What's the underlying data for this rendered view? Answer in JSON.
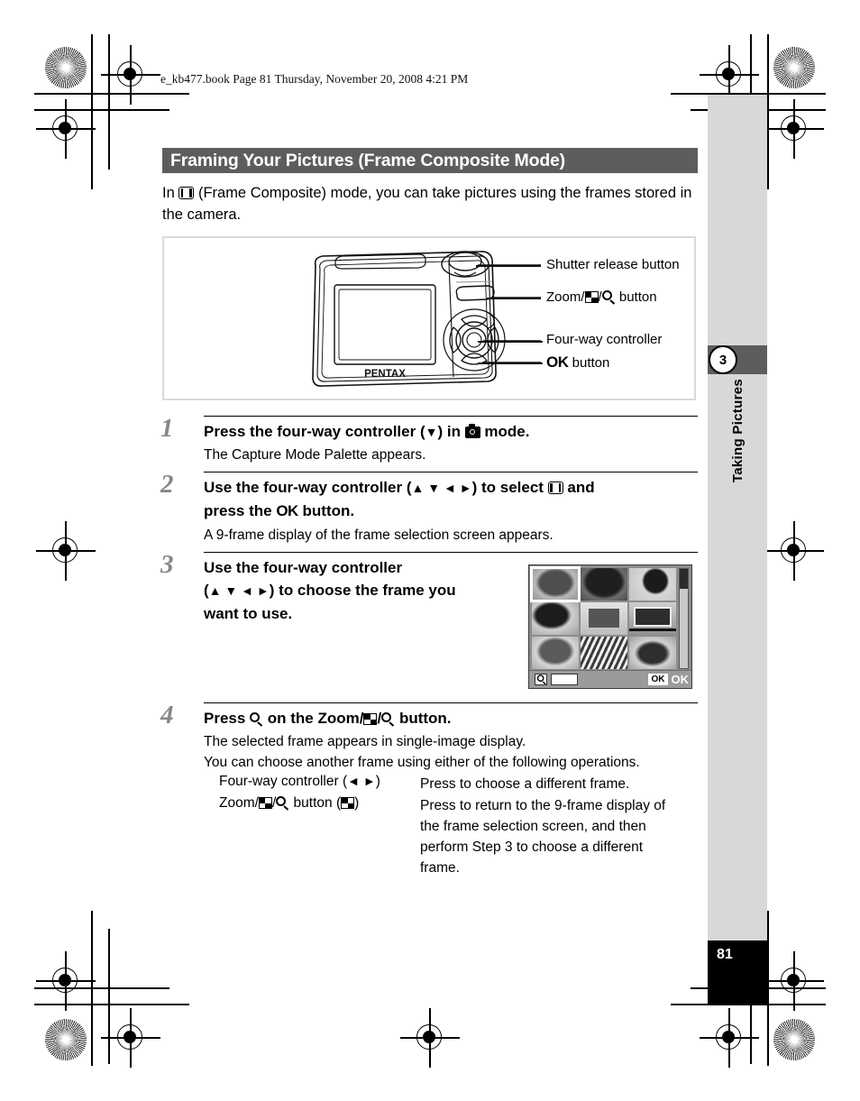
{
  "header": {
    "book_line": "e_kb477.book  Page 81  Thursday, November 20, 2008  4:21 PM"
  },
  "title": {
    "heading": "Framing Your Pictures (Frame Composite Mode)"
  },
  "intro": {
    "before_icon": "In ",
    "icon": "frame-composite-icon",
    "after_icon": " (Frame Composite) mode, you can take pictures using the frames stored in the camera."
  },
  "diagram": {
    "camera_brand": "PENTAX",
    "callouts": [
      "Shutter release button",
      "Zoom/",
      "/",
      " button",
      "Four-way controller",
      "OK",
      " button"
    ],
    "label_shutter": "Shutter release button",
    "label_zoom_pre": "Zoom/",
    "label_zoom_mid": "/",
    "label_zoom_post": " button",
    "label_fourway": "Four-way controller",
    "label_ok_pre": "OK",
    "label_ok_post": " button"
  },
  "steps": [
    {
      "num": "1",
      "head_a": "Press the four-way controller (",
      "head_arrows": "▼",
      "head_b": ") in ",
      "head_c": " mode.",
      "body": "The Capture Mode Palette appears."
    },
    {
      "num": "2",
      "head_a": "Use the four-way controller (",
      "head_arrows": "▲ ▼ ◄ ►",
      "head_b": ") to select ",
      "head_c": " and",
      "head_line2_a": "press the ",
      "head_line2_ok": "OK",
      "head_line2_b": " button.",
      "body": "A 9-frame display of the frame selection screen appears."
    },
    {
      "num": "3",
      "head_line1": "Use the four-way controller",
      "head_line2_a": "(",
      "head_arrows": "▲ ▼ ◄ ►",
      "head_line2_b": ") to choose the frame you",
      "head_line3": "want to use."
    },
    {
      "num": "4",
      "head_a": "Press ",
      "head_b": " on the Zoom/",
      "head_c": "/",
      "head_d": " button.",
      "body_line1": "The selected frame appears in single-image display.",
      "body_line2": "You can choose another frame using either of the following operations.",
      "op1_label_a": "Four-way controller (",
      "op1_arrows": "◄ ►",
      "op1_label_b": ")",
      "op1_desc": "Press to choose a different frame.",
      "op2_label_a": "Zoom/",
      "op2_label_b": "/",
      "op2_label_c": " button (",
      "op2_label_d": ")",
      "op2_desc_line1": "Press to return to the 9-frame display of",
      "op2_desc_line2": "the frame selection screen, and then",
      "op2_desc_line3": "perform Step 3 to choose a different",
      "op2_desc_line4": "frame."
    }
  ],
  "lcd": {
    "ok_button_label": "OK",
    "ok_text_label": "OK",
    "selected_index": 0,
    "thumbnail_count": 9
  },
  "sidebar": {
    "chapter_number": "3",
    "chapter_title": "Taking Pictures",
    "page_number": "81"
  },
  "colors": {
    "title_bar": "#5d5d5d",
    "gray_band": "#d8d8d8",
    "page_block": "#000000",
    "step_number": "#878787"
  }
}
